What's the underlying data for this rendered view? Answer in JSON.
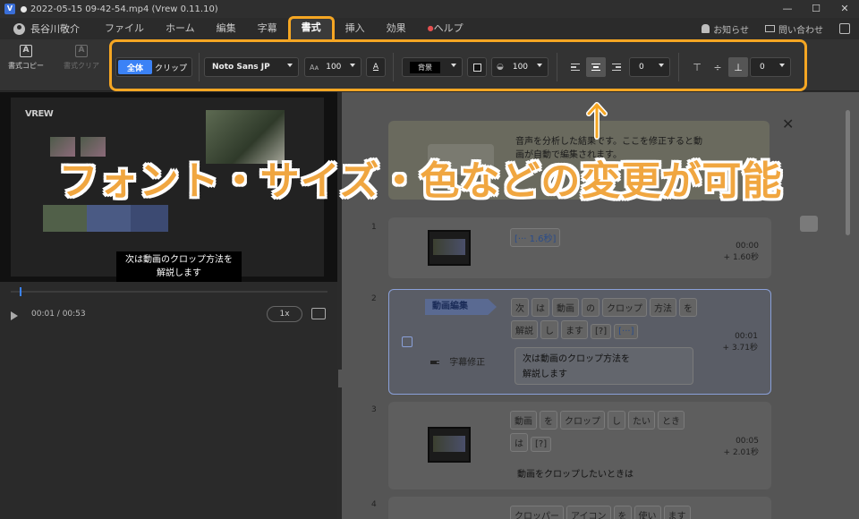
{
  "titlebar": {
    "app_icon": "V",
    "title": "2022-05-15 09-42-54.mp4 (Vrew 0.11.10)",
    "controls": [
      "—",
      "☐",
      "✕"
    ]
  },
  "menubar": {
    "user": "長谷川敬介",
    "tabs": [
      "ファイル",
      "ホーム",
      "編集",
      "字幕",
      "書式",
      "挿入",
      "効果",
      "ヘルプ"
    ],
    "active_tab": "書式",
    "right": {
      "news": "お知らせ",
      "contact": "問い合わせ"
    }
  },
  "toolbar": {
    "copy_format": "書式コピー",
    "clear_format": "書式クリア",
    "scope_all": "全体",
    "scope_clip": "クリップ",
    "font": "Noto Sans JP",
    "font_size": "100",
    "bg_label": "背景",
    "opacity": "100",
    "line_spacing": "0",
    "vertical_offset": "0"
  },
  "preview": {
    "logo": "VREW",
    "subtitle_line1": "次は動画のクロップ方法を",
    "subtitle_line2": "解説します"
  },
  "player": {
    "time": "00:01 / 00:53",
    "speed": "1x"
  },
  "tip": {
    "line1": "音声を分析した結果です。ここを修正すると動",
    "line2": "画が自動で編集されます。"
  },
  "clips": [
    {
      "num": "1",
      "words": [
        "[··· 1.6秒]"
      ],
      "time": "00:00",
      "duration": "+ 1.60秒"
    },
    {
      "num": "2",
      "tag": "動画編集",
      "words": [
        "次",
        "は",
        "動画",
        "の",
        "クロップ",
        "方法",
        "を",
        "解説",
        "し",
        "ます",
        "[?]",
        "[···]"
      ],
      "time": "00:01",
      "duration": "+ 3.71秒",
      "subfix_label": "字幕修正",
      "subtitle_line1": "次は動画のクロップ方法を",
      "subtitle_line2": "解説します"
    },
    {
      "num": "3",
      "words": [
        "動画",
        "を",
        "クロップ",
        "し",
        "たい",
        "とき",
        "は",
        "[?]"
      ],
      "time": "00:05",
      "duration": "+ 2.01秒",
      "subtitle": "動画をクロップしたいときは"
    },
    {
      "num": "4",
      "words": [
        "クロッパー",
        "アイコン",
        "を",
        "使い",
        "ます"
      ]
    }
  ],
  "overlay": {
    "caption": "フォント・サイズ・色などの変更が可能"
  },
  "colors": {
    "accent": "#f5a623",
    "primary": "#3b82f6",
    "caption": "#f0a640"
  }
}
